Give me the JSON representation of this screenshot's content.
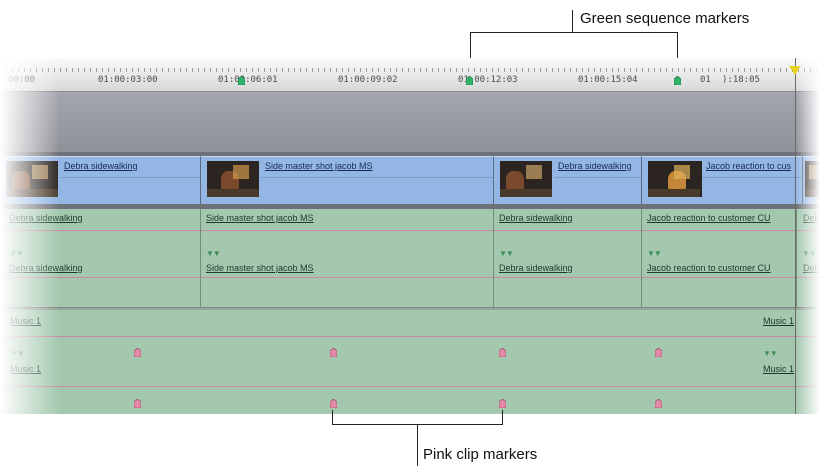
{
  "callouts": {
    "sequence_markers": "Green sequence markers",
    "clip_markers": "Pink clip markers"
  },
  "ruler": {
    "timecodes": [
      "00:00",
      "01:00:03:00",
      "01:00:06:01",
      "01:00:09:02",
      "01:00:12:03",
      "01:00:15:04",
      "01",
      "):18:05"
    ]
  },
  "video_track": {
    "clips": [
      {
        "label": "Debra sidewalking"
      },
      {
        "label": "Side master shot jacob MS"
      },
      {
        "label": "Debra sidewalking"
      },
      {
        "label": "Jacob reaction to cus"
      }
    ]
  },
  "audio_tracks": {
    "a1": {
      "clips": [
        {
          "label": "Debra sidewalking"
        },
        {
          "label": "Side master shot jacob MS"
        },
        {
          "label": "Debra sidewalking"
        },
        {
          "label": "Jacob reaction to customer CU"
        },
        {
          "label": "Deb"
        }
      ]
    },
    "a2": {
      "clips": [
        {
          "label": "Debra sidewalking"
        },
        {
          "label": "Side master shot jacob MS"
        },
        {
          "label": "Debra sidewalking"
        },
        {
          "label": "Jacob reaction to customer CU"
        },
        {
          "label": "Deb"
        }
      ]
    },
    "a3": {
      "clips": [
        {
          "label": "Music 1"
        },
        {
          "label": "Music 1"
        }
      ]
    },
    "a4": {
      "clips": [
        {
          "label": "Music 1"
        },
        {
          "label": "Music 1"
        }
      ]
    }
  },
  "colors": {
    "sequence_marker": "#2fb36a",
    "clip_marker": "#e48aa9",
    "playhead": "#e6d21a",
    "video_clip": "#93b6e4",
    "audio_clip": "#a3c8ae"
  },
  "icons": {
    "sequence_marker": "sequence-marker-icon",
    "clip_marker": "clip-marker-icon",
    "playhead": "playhead-icon",
    "link_indicator": "link-indicator-icon"
  }
}
